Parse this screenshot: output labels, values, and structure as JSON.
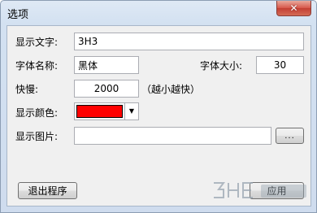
{
  "window": {
    "title": "选项",
    "close_glyph": "✕"
  },
  "form": {
    "display_text": {
      "label": "显示文字:",
      "value": "3H3"
    },
    "font_name": {
      "label": "字体名称:",
      "value": "黑体"
    },
    "font_size": {
      "label": "字体大小:",
      "value": "30"
    },
    "speed": {
      "label": "快慢:",
      "value": "2000",
      "hint": "（越小越快）"
    },
    "display_color": {
      "label": "显示颜色:",
      "value": "#ff0000"
    },
    "display_image": {
      "label": "显示图片:",
      "value": "",
      "browse_label": "..."
    }
  },
  "buttons": {
    "exit_label": "退出程序",
    "apply_label": "应用"
  },
  "watermark": {
    "logo_text": "3HE",
    "accent": "#9aa6b2"
  },
  "colors": {
    "selected_color": "#ff0000"
  }
}
